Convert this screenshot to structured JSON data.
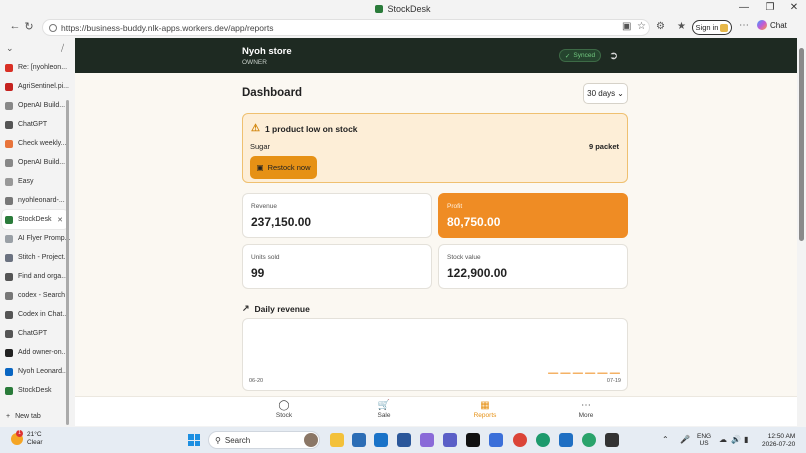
{
  "window": {
    "title": "StockDesk"
  },
  "browser": {
    "url": "https://business-buddy.nlk-apps.workers.dev/app/reports",
    "signin_label": "Sign in",
    "chat_label": "Chat"
  },
  "tabs": [
    {
      "label": "Re: [nyohleon...",
      "icon": "gmail-icon",
      "color": "#d93025"
    },
    {
      "label": "AgriSentinel.pi...",
      "icon": "pdf-icon",
      "color": "#c5221f"
    },
    {
      "label": "OpenAI Build...",
      "icon": "openai-icon",
      "color": "#888888"
    },
    {
      "label": "ChatGPT",
      "icon": "chatgpt-icon",
      "color": "#555555"
    },
    {
      "label": "Check weekly...",
      "icon": "tracker-icon",
      "color": "#e8743b"
    },
    {
      "label": "OpenAI Build...",
      "icon": "openai-icon",
      "color": "#888888"
    },
    {
      "label": "Easy",
      "icon": "globe-icon",
      "color": "#999999"
    },
    {
      "label": "nyohleonard-...",
      "icon": "github-icon",
      "color": "#777777"
    },
    {
      "label": "StockDesk",
      "icon": "stockdesk-icon",
      "color": "#2a7b3a",
      "active": true
    },
    {
      "label": "AI Flyer Promp...",
      "icon": "sparkle-icon",
      "color": "#9aa0a6"
    },
    {
      "label": "Stitch - Project...",
      "icon": "stitch-icon",
      "color": "#6b7280"
    },
    {
      "label": "Find and orga...",
      "icon": "chatgpt-icon",
      "color": "#555555"
    },
    {
      "label": "codex - Search",
      "icon": "search-icon",
      "color": "#777777"
    },
    {
      "label": "Codex in Chat...",
      "icon": "openai-icon",
      "color": "#555555"
    },
    {
      "label": "ChatGPT",
      "icon": "chatgpt-icon",
      "color": "#555555"
    },
    {
      "label": "Add owner-on...",
      "icon": "github-icon",
      "color": "#222222"
    },
    {
      "label": "Nyoh Leonard...",
      "icon": "linkedin-icon",
      "color": "#0a66c2"
    },
    {
      "label": "StockDesk",
      "icon": "stockdesk-icon",
      "color": "#2a7b3a"
    }
  ],
  "new_tab_label": "New tab",
  "app": {
    "store_name": "Nyoh store",
    "role": "OWNER",
    "sync_status": "Synced",
    "page_title": "Dashboard",
    "range": "30 days",
    "alert": {
      "title": "1 product low on stock",
      "item": "Sugar",
      "qty": "9 packet",
      "button": "Restock now"
    },
    "kpis": {
      "revenue": {
        "label": "Revenue",
        "value": "237,150.00"
      },
      "profit": {
        "label": "Profit",
        "value": "80,750.00"
      },
      "units": {
        "label": "Units sold",
        "value": "99"
      },
      "stock": {
        "label": "Stock value",
        "value": "122,900.00"
      }
    },
    "daily_revenue_title": "Daily revenue",
    "nav": {
      "stock": "Stock",
      "sale": "Sale",
      "reports": "Reports",
      "more": "More"
    },
    "accent": "#ef8c24",
    "header_bg": "#1e2a22"
  },
  "chart_data": {
    "type": "bar",
    "x_start": "06-20",
    "x_end": "07-19",
    "days": 30,
    "nonzero_bars": [
      24,
      25,
      26,
      27,
      28,
      29
    ],
    "values": [
      0,
      0,
      0,
      0,
      0,
      0,
      0,
      0,
      0,
      0,
      0,
      0,
      0,
      0,
      0,
      0,
      0,
      0,
      0,
      0,
      0,
      0,
      0,
      0,
      1,
      1,
      1,
      1,
      1,
      1
    ]
  },
  "taskbar": {
    "weather_temp": "21°C",
    "weather_desc": "Clear",
    "weather_badge": "1",
    "search_label": "Search",
    "lang_top": "ENG",
    "lang_bottom": "US",
    "time": "12:50 AM",
    "date": "2026-07-20"
  }
}
